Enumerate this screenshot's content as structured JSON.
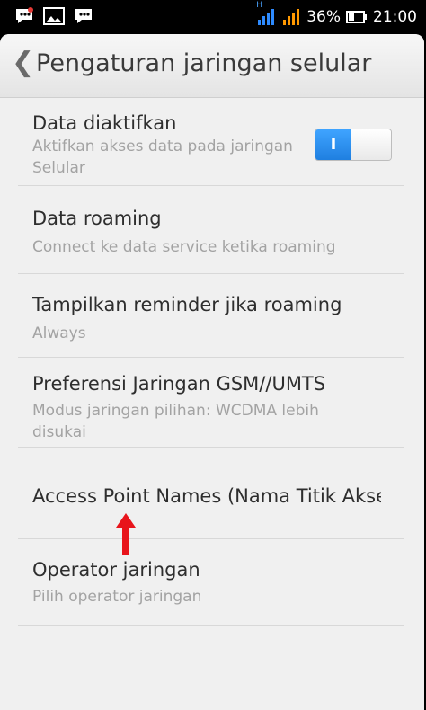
{
  "status_bar": {
    "battery_percent": "36%",
    "time": "21:00",
    "network_indicator": "H"
  },
  "header": {
    "title": "Pengaturan jaringan selular"
  },
  "items": [
    {
      "title": "Data diaktifkan",
      "subtitle": "Aktifkan akses data pada jaringan Selular",
      "toggle_label": "I"
    },
    {
      "title": "Data roaming",
      "subtitle": "Connect ke data service ketika roaming"
    },
    {
      "title": "Tampilkan reminder jika roaming",
      "subtitle": "Always"
    },
    {
      "title": "Preferensi Jaringan GSM//UMTS",
      "subtitle": "Modus jaringan pilihan: WCDMA lebih disukai"
    },
    {
      "title": "Access Point Names (Nama Titik Akses)"
    },
    {
      "title": "Operator jaringan",
      "subtitle": "Pilih operator jaringan"
    }
  ],
  "colors": {
    "toggle_on": "#2a8ff0",
    "annotation_arrow": "#e8141b"
  }
}
